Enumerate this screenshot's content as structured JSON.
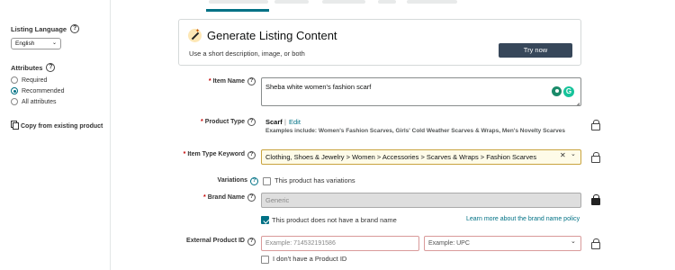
{
  "sidebar": {
    "listing_language": "Listing Language",
    "language_value": "English",
    "attributes_heading": "Attributes",
    "attribute_options": [
      {
        "label": "Required",
        "selected": false
      },
      {
        "label": "Recommended",
        "selected": true
      },
      {
        "label": "All attributes",
        "selected": false
      }
    ],
    "copy_label": "Copy from existing product"
  },
  "generate": {
    "title": "Generate Listing Content",
    "subtitle": "Use a short description, image, or both",
    "button": "Try now"
  },
  "form": {
    "item_name": {
      "label": "Item Name",
      "value": "Sheba white women's fashion scarf"
    },
    "product_type": {
      "label": "Product Type",
      "value": "Scarf",
      "separator": "|",
      "edit": "Edit",
      "examples": "Examples include: Women's Fashion Scarves, Girls' Cold Weather Scarves & Wraps, Men's Novelty Scarves"
    },
    "item_type_keyword": {
      "label": "Item Type Keyword",
      "value": "Clothing, Shoes & Jewelry > Women > Accessories > Scarves & Wraps > Fashion Scarves"
    },
    "variations": {
      "label": "Variations",
      "checkbox_label": "This product has variations",
      "checked": false
    },
    "brand_name": {
      "label": "Brand Name",
      "placeholder": "Generic",
      "no_brand_label": "This product does not have a brand name",
      "no_brand_checked": true,
      "learn_more": "Learn more about the brand name policy"
    },
    "external_product_id": {
      "label": "External Product ID",
      "placeholder": "Example: 714532191586",
      "type_placeholder": "Example: UPC",
      "no_id_label": "I don't have a Product ID",
      "no_id_checked": false
    }
  },
  "colors": {
    "accent": "#007185",
    "button": "#37475a",
    "required": "#c40000"
  }
}
